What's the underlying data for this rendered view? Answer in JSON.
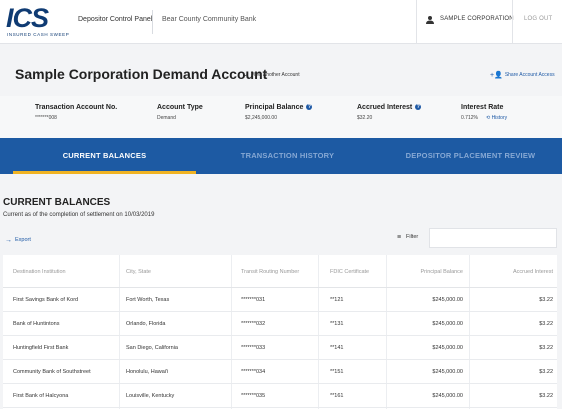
{
  "header": {
    "logo_text": "ICS",
    "logo_tagline": "INSURED CASH SWEEP",
    "app_title": "Depositor Control Panel",
    "bank_name": "Bear County Community Bank",
    "user_name": "SAMPLE CORPORATION",
    "logout_label": "LOG OUT"
  },
  "account": {
    "title": "Sample Corporation Demand Account",
    "view_another": "View Another Account",
    "share_label": "Share Account Access"
  },
  "summary": {
    "account_no_label": "Transaction Account No.",
    "account_no_value": "*******008",
    "type_label": "Account Type",
    "type_value": "Demand",
    "principal_label": "Principal Balance",
    "principal_value": "$2,245,000.00",
    "interest_label": "Accrued Interest",
    "interest_value": "$32.20",
    "rate_label": "Interest Rate",
    "rate_value": "0.712%",
    "history_label": "History"
  },
  "tabs": [
    {
      "label": "CURRENT BALANCES"
    },
    {
      "label": "TRANSACTION HISTORY"
    },
    {
      "label": "DEPOSITOR PLACEMENT REVIEW"
    }
  ],
  "section": {
    "title": "CURRENT BALANCES",
    "subtitle": "Current as of the completion of settlement on 10/03/2019",
    "export_label": "Export",
    "filter_label": "Filter",
    "filter_value": ""
  },
  "table": {
    "columns": [
      "Destination Institution",
      "City, State",
      "Transit Routing Number",
      "FDIC Certificate",
      "Principal Balance",
      "Accrued Interest"
    ],
    "rows": [
      [
        "First Savings Bank of Kord",
        "Fort Worth, Texas",
        "*******031",
        "**121",
        "$245,000.00",
        "$3.22"
      ],
      [
        "Bank of Huntintons",
        "Orlando, Florida",
        "*******032",
        "**131",
        "$245,000.00",
        "$3.22"
      ],
      [
        "Huntingfield First Bank",
        "San Diego, California",
        "*******033",
        "**141",
        "$245,000.00",
        "$3.22"
      ],
      [
        "Community Bank of Southstreet",
        "Honolulu, Hawai'i",
        "*******034",
        "**151",
        "$245,000.00",
        "$3.22"
      ],
      [
        "First Bank of Halcyona",
        "Louisville, Kentucky",
        "*******035",
        "**161",
        "$245,000.00",
        "$3.22"
      ]
    ]
  },
  "colors": {
    "primary": "#1d5aa3",
    "tab_indicator": "#f0b323",
    "link": "#1f5aa6"
  }
}
